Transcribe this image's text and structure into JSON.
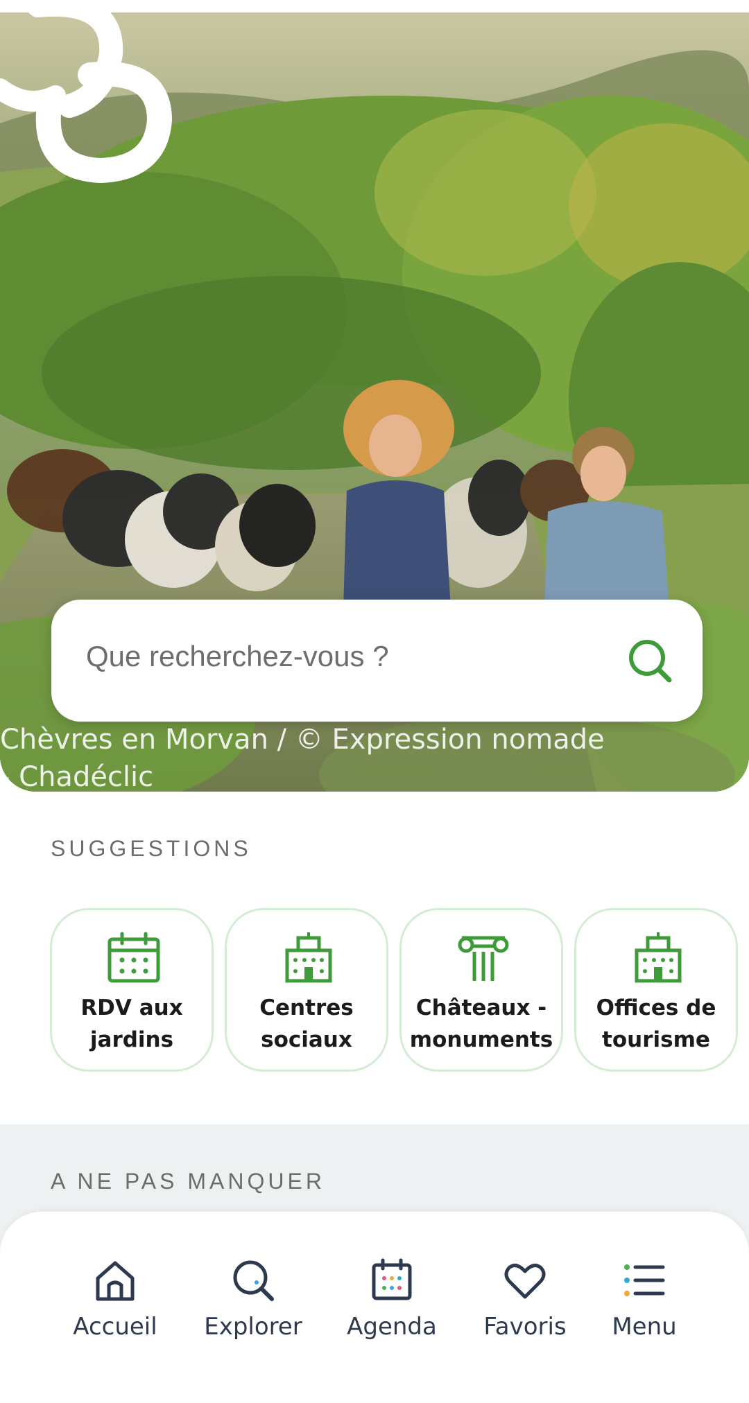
{
  "hero": {
    "search_placeholder": "Que recherchez-vous ?",
    "photo_credit": "Chèvres en Morvan / © Expression nomade - Chadéclic"
  },
  "suggestions": {
    "title": "SUGGESTIONS",
    "items": [
      {
        "label": "RDV aux jardins",
        "icon": "calendar-icon"
      },
      {
        "label": "Centres sociaux",
        "icon": "building-icon"
      },
      {
        "label": "Châteaux - monuments",
        "icon": "column-icon"
      },
      {
        "label": "Offices de tourisme",
        "icon": "building-icon"
      }
    ]
  },
  "ne_pas_manquer": {
    "title": "A NE PAS MANQUER"
  },
  "nav": {
    "items": [
      {
        "label": "Accueil",
        "icon": "home-icon"
      },
      {
        "label": "Explorer",
        "icon": "search-icon"
      },
      {
        "label": "Agenda",
        "icon": "calendar-icon"
      },
      {
        "label": "Favoris",
        "icon": "heart-icon"
      },
      {
        "label": "Menu",
        "icon": "menu-icon"
      }
    ]
  },
  "colors": {
    "accent_green": "#3f9a3a",
    "nav_text": "#2d3a4e",
    "card_border": "#d4ecd4"
  }
}
